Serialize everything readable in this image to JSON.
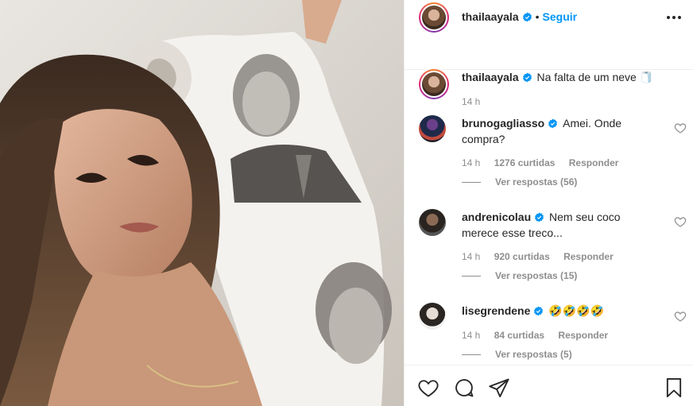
{
  "post": {
    "author": {
      "username": "thailaayala",
      "follow_label": "Seguir",
      "separator": "•"
    },
    "caption": {
      "username": "thailaayala",
      "text": "Na falta de um neve 🧻",
      "time": "14 h"
    },
    "comments": [
      {
        "username": "brunogagliasso",
        "text": "Amei. Onde",
        "text2": "compra?",
        "time": "14 h",
        "likes": "1276 curtidas",
        "reply_label": "Responder",
        "view_replies": "Ver respostas (56)"
      },
      {
        "username": "andrenicolau",
        "text": "Nem seu coco",
        "text2": "merece esse treco...",
        "time": "14 h",
        "likes": "920 curtidas",
        "reply_label": "Responder",
        "view_replies": "Ver respostas (15)"
      },
      {
        "username": "lisegrendene",
        "text": "🤣🤣🤣🤣",
        "time": "14 h",
        "likes": "84 curtidas",
        "reply_label": "Responder",
        "view_replies": "Ver respostas (5)"
      }
    ]
  },
  "icons": {
    "verified": "verified-badge-icon",
    "more": "more-options-icon",
    "like": "heart-icon",
    "comment": "comment-icon",
    "share": "paper-plane-icon",
    "save": "bookmark-icon"
  },
  "colors": {
    "link": "#0095f6",
    "secondary_text": "#8e8e8e",
    "primary_text": "#262626"
  }
}
